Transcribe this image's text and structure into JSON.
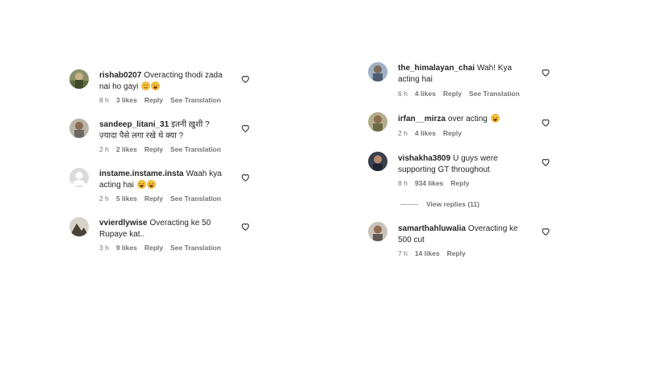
{
  "left_comments": [
    {
      "username": "rishab0207",
      "text": "Overacting thodi zada nai ho gayi",
      "emojis": [
        "smirk-face",
        "laughing-face"
      ],
      "time": "8 h",
      "likes": "3 likes",
      "reply": "Reply",
      "translate": "See Translation",
      "avatar": "avatar-rishab"
    },
    {
      "username": "sandeep_litani_31",
      "text": "इतनी ख़ुशी ? ज़्यादा पैसे लगा रखे थे क्या ?",
      "emojis": [],
      "time": "2 h",
      "likes": "2 likes",
      "reply": "Reply",
      "translate": "See Translation",
      "avatar": "avatar-sandeep"
    },
    {
      "username": "instame.instame.insta",
      "text": "Waah kya acting hai",
      "emojis": [
        "laughing-face",
        "laughing-face"
      ],
      "time": "2 h",
      "likes": "5 likes",
      "reply": "Reply",
      "translate": "See Translation",
      "avatar": "avatar-default"
    },
    {
      "username": "vvierdlywise",
      "text": "Overacting ke 50 Rupaye kat..",
      "emojis": [],
      "time": "3 h",
      "likes": "9 likes",
      "reply": "Reply",
      "translate": "See Translation",
      "avatar": "avatar-vvierd"
    }
  ],
  "right_comments": [
    {
      "username": "the_himalayan_chai",
      "text": "Wah! Kya acting hai",
      "emojis": [],
      "time": "6 h",
      "likes": "4 likes",
      "reply": "Reply",
      "translate": "See Translation",
      "avatar": "avatar-himalayan"
    },
    {
      "username": "irfan__mirza",
      "text": "over acting",
      "emojis": [
        "laughing-face"
      ],
      "time": "2 h",
      "likes": "4 likes",
      "reply": "Reply",
      "translate": "",
      "avatar": "avatar-irfan"
    },
    {
      "username": "vishakha3809",
      "text": "U guys were supporting GT throughout",
      "emojis": [],
      "time": "8 h",
      "likes": "934 likes",
      "reply": "Reply",
      "translate": "",
      "avatar": "avatar-vishakha"
    },
    {
      "username": "samarthahluwalia",
      "text": "Overacting ke 500 cut",
      "emojis": [],
      "time": "7 h",
      "likes": "14 likes",
      "reply": "Reply",
      "translate": "",
      "avatar": "avatar-samarth"
    }
  ],
  "view_replies": "View replies (11)",
  "colors": {
    "text": "#262626",
    "meta": "#737373",
    "heart_stroke": "#262626",
    "line": "#b3b3b3"
  }
}
